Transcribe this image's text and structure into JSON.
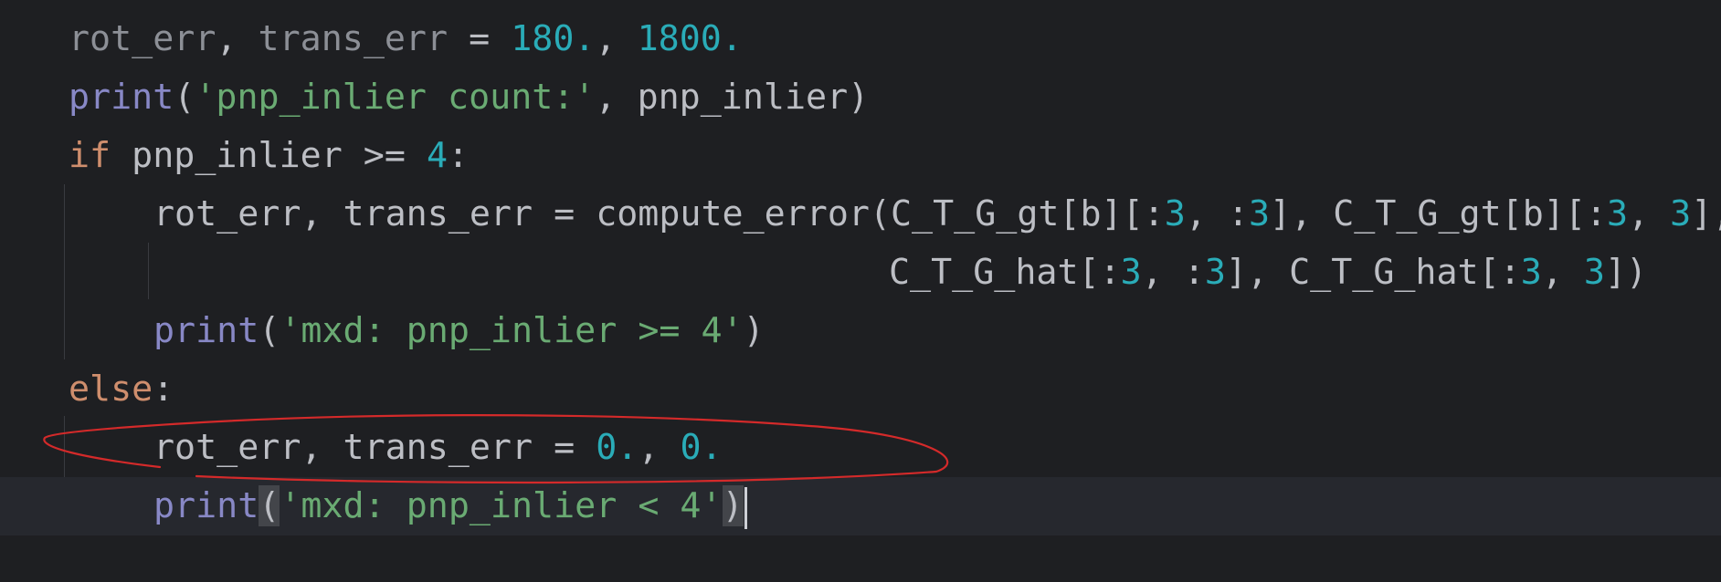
{
  "editor": {
    "lines": {
      "l1": {
        "var1": "rot_err",
        "comma1": ", ",
        "var2": "trans_err",
        "eq": " = ",
        "num1": "180.",
        "comma2": ", ",
        "num2": "1800."
      },
      "l2": {
        "fn": "print",
        "open": "(",
        "str": "'pnp_inlier count:'",
        "sep": ", ",
        "arg": "pnp_inlier",
        "close": ")"
      },
      "l3": {
        "kw": "if",
        "cond": " pnp_inlier >= ",
        "num": "4",
        "colon": ":"
      },
      "l4": {
        "t1": "rot_err, trans_err = compute_error(C_T_G_gt[b][:",
        "n1": "3",
        "t2": ", :",
        "n2": "3",
        "t3": "], C_T_G_gt[b][:",
        "n3": "3",
        "t4": ", ",
        "n4": "3",
        "t5": "],"
      },
      "l5": {
        "t1": "C_T_G_hat[:",
        "n1": "3",
        "t2": ", :",
        "n2": "3",
        "t3": "], C_T_G_hat[:",
        "n3": "3",
        "t4": ", ",
        "n4": "3",
        "t5": "])"
      },
      "l6": {
        "fn": "print",
        "open": "(",
        "str": "'mxd: pnp_inlier >= 4'",
        "close": ")"
      },
      "l7": {
        "kw": "else",
        "colon": ":"
      },
      "l8": {
        "t1": "rot_err, trans_err = ",
        "n1": "0.",
        "sep": ", ",
        "n2": "0."
      },
      "l9": {
        "fn": "print",
        "open": "(",
        "str": "'mxd: pnp_inlier < 4'",
        "close": ")"
      }
    }
  },
  "colors": {
    "background": "#1e1f22",
    "current_line": "#26282e",
    "default_text": "#bcbec4",
    "keyword": "#cf8e6d",
    "number": "#2aacb8",
    "string": "#6aab73",
    "builtin": "#8888c6",
    "muted_text": "#8c8f96",
    "annotation_stroke": "#d42a2a"
  }
}
